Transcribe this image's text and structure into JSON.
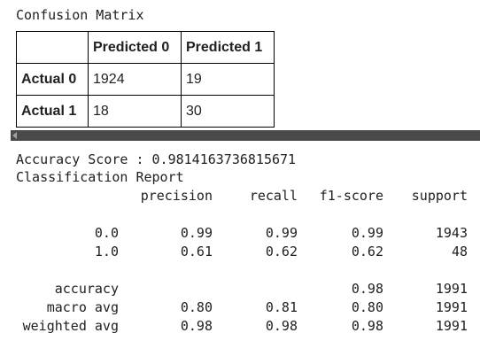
{
  "confusion_matrix": {
    "title": "Confusion Matrix",
    "columns": [
      "Predicted 0",
      "Predicted 1"
    ],
    "rows": [
      {
        "label": "Actual 0",
        "values": [
          "1924",
          "19"
        ]
      },
      {
        "label": "Actual 1",
        "values": [
          "18",
          "30"
        ]
      }
    ]
  },
  "accuracy_line": "Accuracy Score : 0.9814163736815671",
  "report_title": "Classification Report",
  "report": {
    "headers": [
      "precision",
      "recall",
      "f1-score",
      "support"
    ],
    "rows": [
      {
        "label": "0.0",
        "values": [
          "0.99",
          "0.99",
          "0.99",
          "1943"
        ]
      },
      {
        "label": "1.0",
        "values": [
          "0.61",
          "0.62",
          "0.62",
          "48"
        ]
      },
      {
        "label": "accuracy",
        "values": [
          "",
          "",
          "0.98",
          "1991"
        ]
      },
      {
        "label": "macro avg",
        "values": [
          "0.80",
          "0.81",
          "0.80",
          "1991"
        ]
      },
      {
        "label": "weighted avg",
        "values": [
          "0.98",
          "0.98",
          "0.98",
          "1991"
        ]
      }
    ]
  }
}
